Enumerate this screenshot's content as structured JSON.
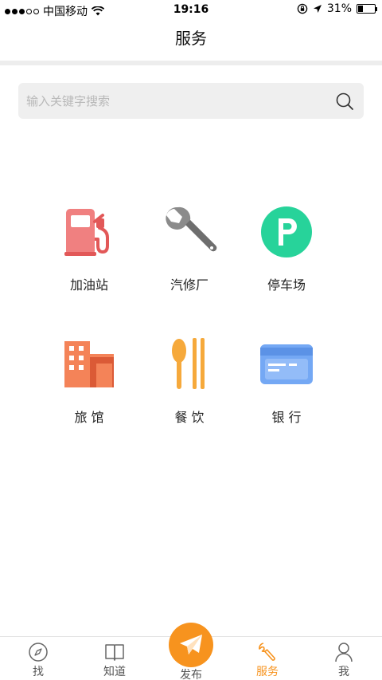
{
  "status_bar": {
    "carrier": "中国移动",
    "time": "19:16",
    "battery_text": "31%",
    "battery_level": 0.31
  },
  "nav": {
    "title": "服务"
  },
  "search": {
    "placeholder": "输入关键字搜索",
    "value": ""
  },
  "services": [
    {
      "label": "加油站",
      "icon": "gas-station-icon",
      "color": "#ee6b6b"
    },
    {
      "label": "汽修厂",
      "icon": "wrench-icon",
      "color": "#8a8a8a"
    },
    {
      "label": "停车场",
      "icon": "parking-icon",
      "color": "#2ed389"
    },
    {
      "label": "旅 馆",
      "icon": "hotel-icon",
      "color": "#f07c4d"
    },
    {
      "label": "餐 饮",
      "icon": "utensils-icon",
      "color": "#f9b23c"
    },
    {
      "label": "银 行",
      "icon": "bank-card-icon",
      "color": "#6aa2f0"
    }
  ],
  "tabs": [
    {
      "label": "找",
      "icon": "compass-icon",
      "active": false
    },
    {
      "label": "知道",
      "icon": "book-icon",
      "active": false
    },
    {
      "label": "发布",
      "icon": "paper-plane-icon",
      "active": false
    },
    {
      "label": "服务",
      "icon": "wrench-icon",
      "active": true
    },
    {
      "label": "我",
      "icon": "person-icon",
      "active": false
    }
  ],
  "colors": {
    "accent": "#f7931e",
    "divider": "#ededed",
    "search_bg": "#efefef"
  }
}
